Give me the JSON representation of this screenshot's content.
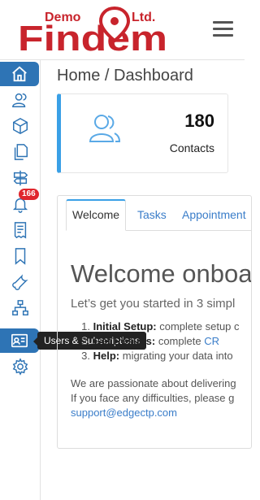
{
  "brand": {
    "name": "Findem",
    "tag_left": "Demo",
    "tag_right": "Ltd.",
    "color": "#c8242c"
  },
  "colors": {
    "accent": "#2e74b5",
    "card_bar": "#3aa0e6",
    "badge": "#e0262d",
    "link": "#3a7dc9"
  },
  "sidebar": {
    "items": [
      {
        "icon": "home-icon",
        "active": true
      },
      {
        "icon": "users-icon"
      },
      {
        "icon": "cube-icon"
      },
      {
        "icon": "documents-icon"
      },
      {
        "icon": "signpost-icon"
      },
      {
        "icon": "bell-icon",
        "badge": "166"
      },
      {
        "icon": "receipt-icon"
      },
      {
        "icon": "bookmark-icon"
      },
      {
        "icon": "wrench-icon"
      },
      {
        "icon": "sitemap-icon"
      },
      {
        "icon": "contact-card-icon",
        "active": true
      },
      {
        "icon": "gear-icon"
      }
    ],
    "tooltip": "Users & Subscriptions"
  },
  "breadcrumb": "Home / Dashboard",
  "stat_card": {
    "count": "180",
    "label": "Contacts",
    "icon": "users-icon"
  },
  "tabs": [
    "Welcome",
    "Tasks",
    "Appointment"
  ],
  "welcome": {
    "title": "Welcome onboa",
    "intro": "Let’s get you started in 3 simpl",
    "steps": [
      {
        "num": "1.",
        "title": "Initial Setup:",
        "text": " complete setup c"
      },
      {
        "num": "2.",
        "title": "Get Results:",
        "text": " complete ",
        "link": "CR"
      },
      {
        "num": "3.",
        "title": "Help:",
        "text": " migrating your data into"
      }
    ],
    "para_line1": "We are passionate about delivering",
    "para_line2": "If you face any difficulties, please g",
    "email": "support@edgectp.com"
  }
}
